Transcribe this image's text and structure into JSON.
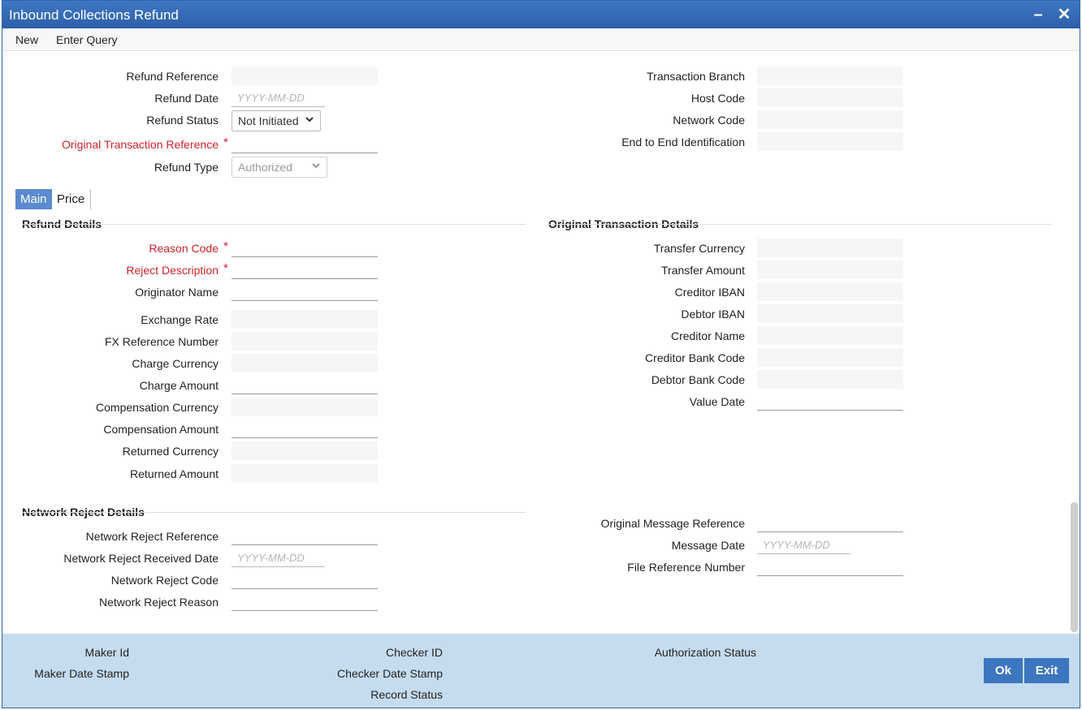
{
  "window": {
    "title": "Inbound Collections Refund"
  },
  "menu": {
    "new": "New",
    "enter_query": "Enter Query"
  },
  "header": {
    "refund_reference": "Refund Reference",
    "refund_date": "Refund Date",
    "refund_date_placeholder": "YYYY-MM-DD",
    "refund_status": "Refund Status",
    "refund_status_value": "Not Initiated",
    "original_txn_reference": "Original Transaction Reference",
    "refund_type": "Refund Type",
    "refund_type_value": "Authorized",
    "transaction_branch": "Transaction Branch",
    "host_code": "Host Code",
    "network_code": "Network Code",
    "end_to_end": "End to End Identification"
  },
  "tabs": {
    "main": "Main",
    "price": "Price"
  },
  "refund_details": {
    "title": "Refund Details",
    "reason_code": "Reason Code",
    "reject_description": "Reject Description",
    "originator_name": "Originator Name",
    "exchange_rate": "Exchange Rate",
    "fx_reference": "FX Reference Number",
    "charge_currency": "Charge Currency",
    "charge_amount": "Charge Amount",
    "compensation_currency": "Compensation Currency",
    "compensation_amount": "Compensation Amount",
    "returned_currency": "Returned Currency",
    "returned_amount": "Returned Amount"
  },
  "original_txn": {
    "title": "Original Transaction Details",
    "transfer_currency": "Transfer Currency",
    "transfer_amount": "Transfer Amount",
    "creditor_iban": "Creditor IBAN",
    "debtor_iban": "Debtor IBAN",
    "creditor_name": "Creditor Name",
    "creditor_bank_code": "Creditor Bank Code",
    "debtor_bank_code": "Debtor Bank Code",
    "value_date": "Value Date"
  },
  "network_reject": {
    "title": "Network Reject Details",
    "reference": "Network Reject Reference",
    "received_date": "Network Reject Received Date",
    "received_date_placeholder": "YYYY-MM-DD",
    "code": "Network Reject Code",
    "reason": "Network Reject Reason",
    "original_msg_ref": "Original Message Reference",
    "message_date": "Message Date",
    "message_date_placeholder": "YYYY-MM-DD",
    "file_reference": "File Reference Number"
  },
  "footer": {
    "maker_id": "Maker Id",
    "maker_date_stamp": "Maker Date Stamp",
    "checker_id": "Checker ID",
    "checker_date_stamp": "Checker Date Stamp",
    "record_status": "Record Status",
    "authorization_status": "Authorization Status",
    "ok": "Ok",
    "exit": "Exit"
  },
  "colors": {
    "titlebar": "#2d5fa8",
    "required": "#d0232c",
    "footer": "#c5dcef",
    "button": "#3c76bf"
  }
}
